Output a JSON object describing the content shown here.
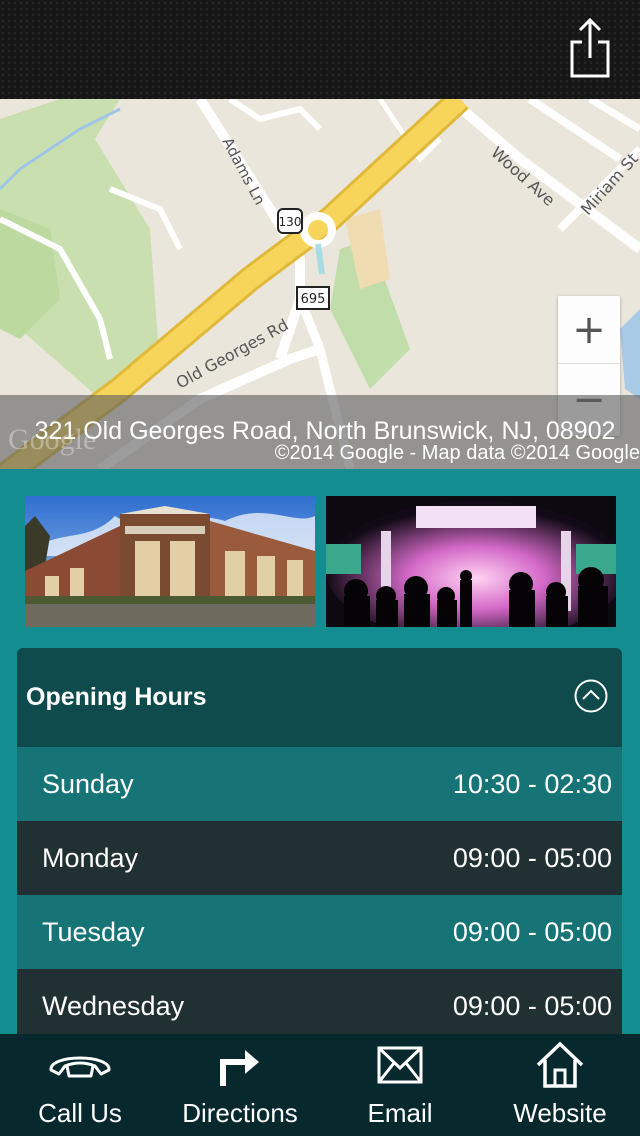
{
  "map": {
    "address": "321 Old Georges Road, North Brunswick, NJ, 08902",
    "attribution": "©2014 Google - Map data ©2014 Google",
    "logo": "Google",
    "zoom_in_label": "+",
    "zoom_out_label": "−",
    "streets": {
      "adams": "Adams Ln",
      "old_georges": "Old Georges Rd",
      "wood": "Wood Ave",
      "miriam": "Miriam St",
      "us130": "130",
      "r695": "695"
    }
  },
  "hours": {
    "title": "Opening Hours",
    "rows": [
      {
        "day": "Sunday",
        "time": "10:30 - 02:30"
      },
      {
        "day": "Monday",
        "time": "09:00 - 05:00"
      },
      {
        "day": "Tuesday",
        "time": "09:00 - 05:00"
      },
      {
        "day": "Wednesday",
        "time": "09:00 - 05:00"
      }
    ]
  },
  "nav": {
    "call": "Call Us",
    "directions": "Directions",
    "email": "Email",
    "website": "Website"
  },
  "icons": {
    "share": "share-icon",
    "collapse": "chevron-up-icon",
    "call": "phone-icon",
    "directions": "arrow-turn-right-icon",
    "email": "envelope-icon",
    "website": "home-icon"
  },
  "colors": {
    "background": "#138d90",
    "header_bar": "#0f4a4c",
    "row_light": "#167376",
    "row_dark": "#213032",
    "nav_bar": "#07282c"
  }
}
